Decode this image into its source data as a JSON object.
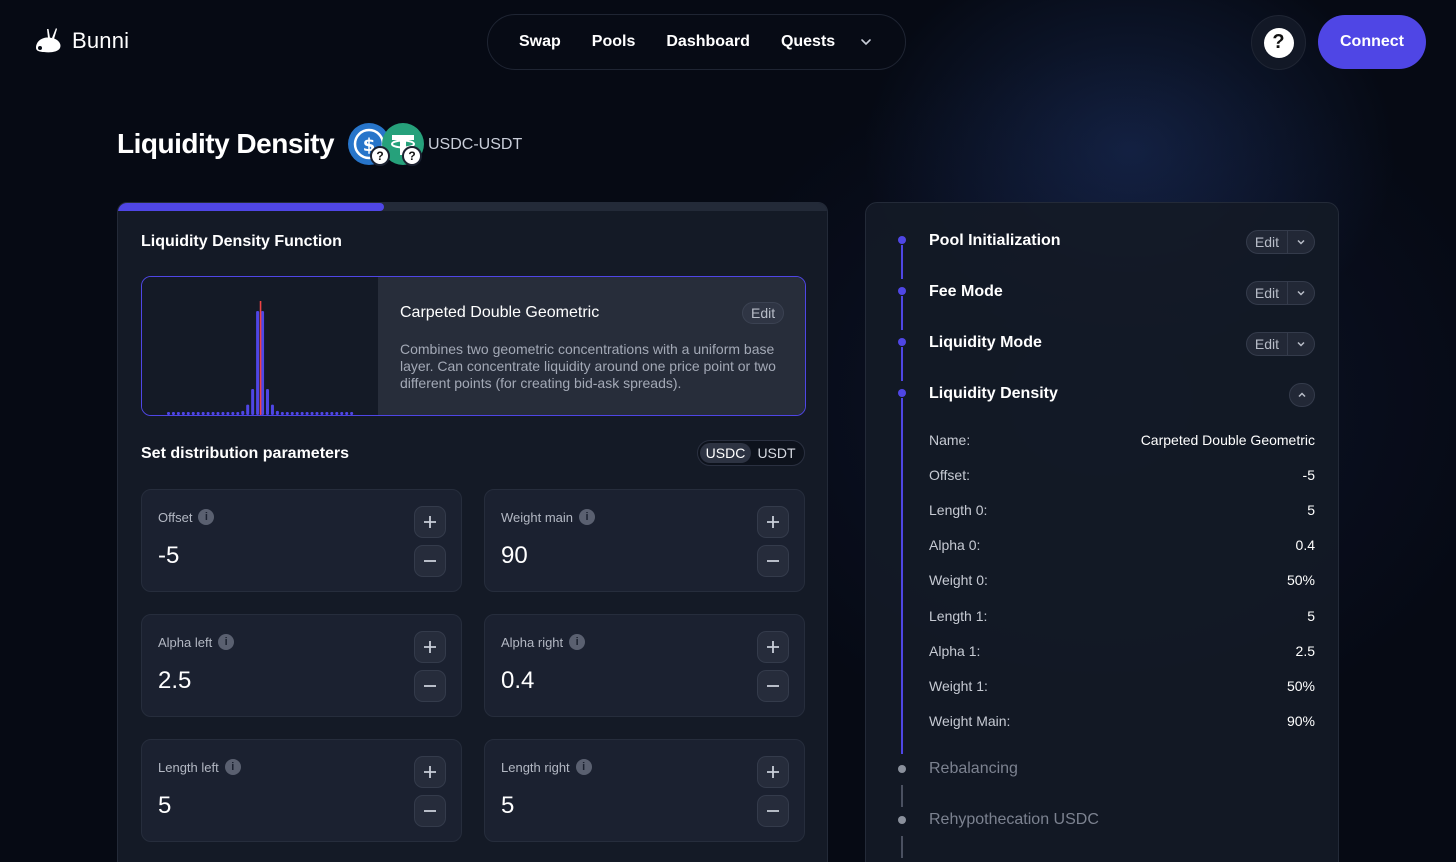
{
  "header": {
    "app_name": "Bunni",
    "nav": [
      "Swap",
      "Pools",
      "Dashboard",
      "Quests"
    ],
    "help_label": "?",
    "connect_label": "Connect"
  },
  "page": {
    "title": "Liquidity Density",
    "pair": "USDC-USDT",
    "token_badge": "?",
    "progress_fraction": 0.375
  },
  "ldf": {
    "section_title": "Liquidity Density Function",
    "name": "Carpeted Double Geometric",
    "edit_label": "Edit",
    "description": "Combines two geometric concentrations with a uniform base layer. Can concentrate liquidity around one price point or two different points (for creating bid-ask spreads).",
    "preview_bars": [
      1,
      1,
      1,
      1,
      1,
      1,
      1,
      1,
      1,
      1,
      1,
      1,
      1,
      1,
      2,
      4,
      10,
      25,
      100,
      100,
      25,
      10,
      4,
      2,
      1,
      1,
      1,
      1,
      1,
      1,
      1,
      1,
      1,
      1,
      1,
      1,
      1,
      1
    ],
    "current_tick_index": 19
  },
  "params": {
    "section_title": "Set distribution parameters",
    "token_toggle": [
      "USDC",
      "USDT"
    ],
    "active_token": "USDC",
    "fields": [
      {
        "label": "Offset",
        "value": "-5"
      },
      {
        "label": "Weight main",
        "value": "90"
      },
      {
        "label": "Alpha left",
        "value": "2.5"
      },
      {
        "label": "Alpha right",
        "value": "0.4"
      },
      {
        "label": "Length left",
        "value": "5"
      },
      {
        "label": "Length right",
        "value": "5"
      }
    ]
  },
  "steps": {
    "items": [
      {
        "title": "Pool Initialization",
        "edit": "Edit"
      },
      {
        "title": "Fee Mode",
        "edit": "Edit"
      },
      {
        "title": "Liquidity Mode",
        "edit": "Edit"
      },
      {
        "title": "Liquidity Density"
      },
      {
        "title": "Rebalancing"
      },
      {
        "title": "Rehypothecation USDC"
      }
    ],
    "details": [
      {
        "k": "Name:",
        "v": "Carpeted Double Geometric"
      },
      {
        "k": "Offset:",
        "v": "-5"
      },
      {
        "k": "Length 0:",
        "v": "5"
      },
      {
        "k": "Alpha 0:",
        "v": "0.4"
      },
      {
        "k": "Weight 0:",
        "v": "50%"
      },
      {
        "k": "Length 1:",
        "v": "5"
      },
      {
        "k": "Alpha 1:",
        "v": "2.5"
      },
      {
        "k": "Weight 1:",
        "v": "50%"
      },
      {
        "k": "Weight Main:",
        "v": "90%"
      }
    ]
  },
  "colors": {
    "accent": "#4f46e5",
    "usdc": "#2775ca",
    "usdt": "#26a17b",
    "tick_marker": "#ef4444"
  }
}
